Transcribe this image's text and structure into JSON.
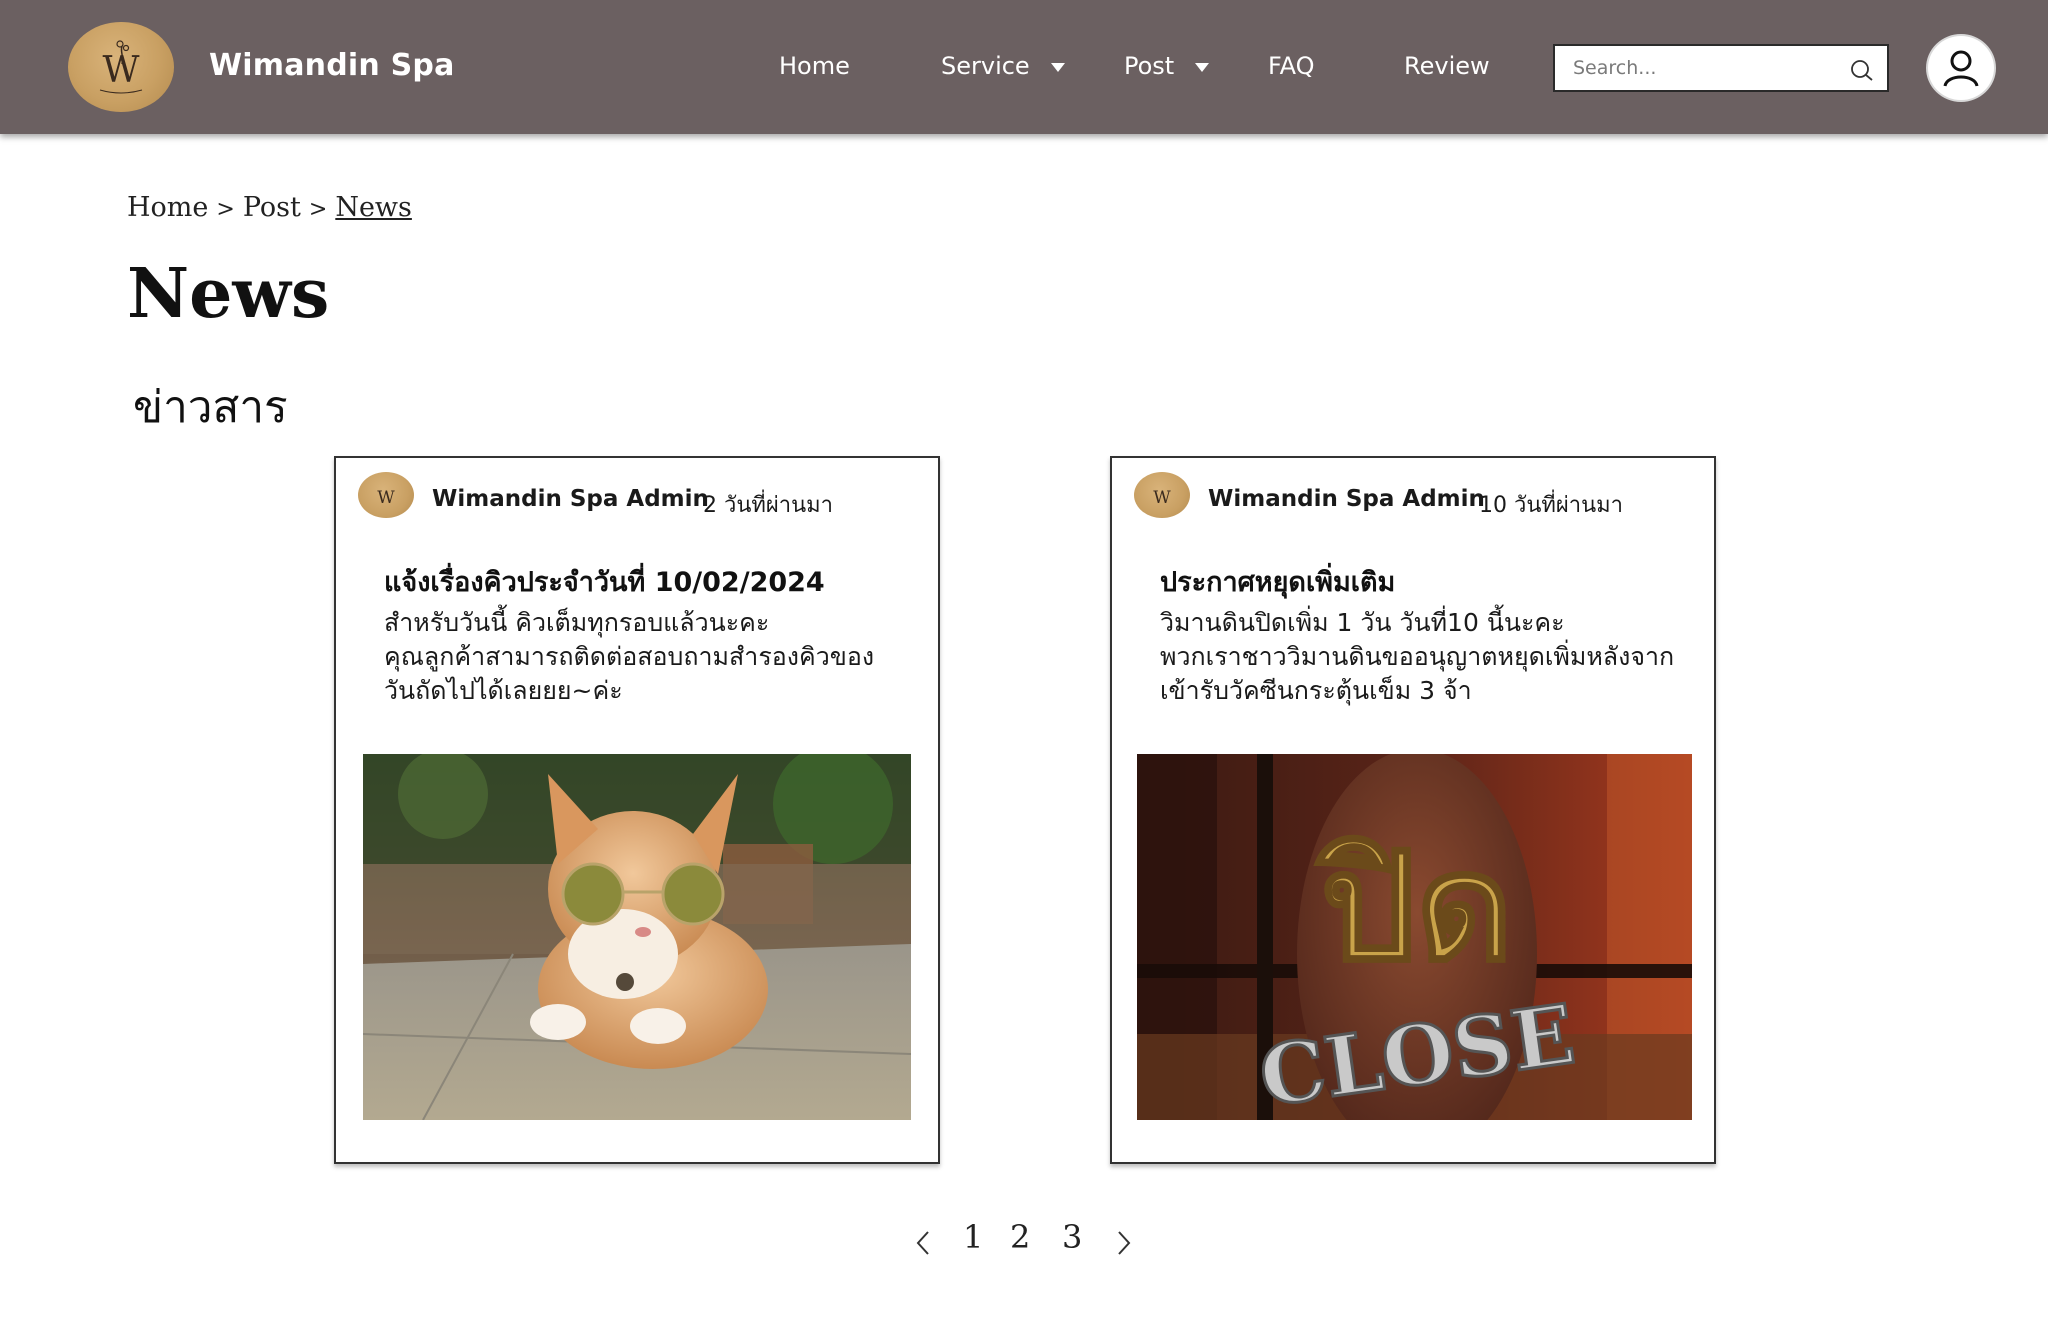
{
  "header": {
    "brand": "Wimandin Spa",
    "nav": [
      {
        "label": "Home"
      },
      {
        "label": "Service"
      },
      {
        "label": "Post"
      },
      {
        "label": "FAQ"
      },
      {
        "label": "Review"
      }
    ],
    "search_placeholder": "Search..."
  },
  "breadcrumb": {
    "items": [
      "Home",
      "Post",
      "News"
    ],
    "separator": ">"
  },
  "page": {
    "title": "News",
    "subtitle": "ข่าวสาร"
  },
  "posts": [
    {
      "author": "Wimandin Spa Admin",
      "time": "2  วันที่ผ่านมา",
      "title": "แจ้งเรื่องคิวประจำวันที่ 10/02/2024",
      "body_lines": [
        "สำหรับวันนี้ คิวเต็มทุกรอบแล้วนะคะ",
        "คุณลูกค้าสามารถติดต่อสอบถามสำรองคิวของ",
        "วันถัดไปได้เลยยย~ค่ะ"
      ],
      "image_desc": "cat-with-sunglasses"
    },
    {
      "author": "Wimandin Spa Admin",
      "time": "10  วันที่ผ่านมา",
      "title": "ประกาศหยุดเพิ่มเติม",
      "body_lines": [
        "วิมานดินปิดเพิ่ม 1 วัน วันที่10 นี้นะคะ",
        "พวกเราชาววิมานดินขออนุญาตหยุดเพิ่มหลังจาก",
        "เข้ารับวัคซีนกระตุ้นเข็ม 3 จ้า"
      ],
      "image_sign_text": "ปิด",
      "image_sign_text_2": "CLOSE"
    }
  ],
  "pagination": {
    "pages": [
      "1",
      "2",
      "3"
    ]
  },
  "colors": {
    "header_bg": "#6b6061",
    "logo_gold": "#c9a063"
  }
}
